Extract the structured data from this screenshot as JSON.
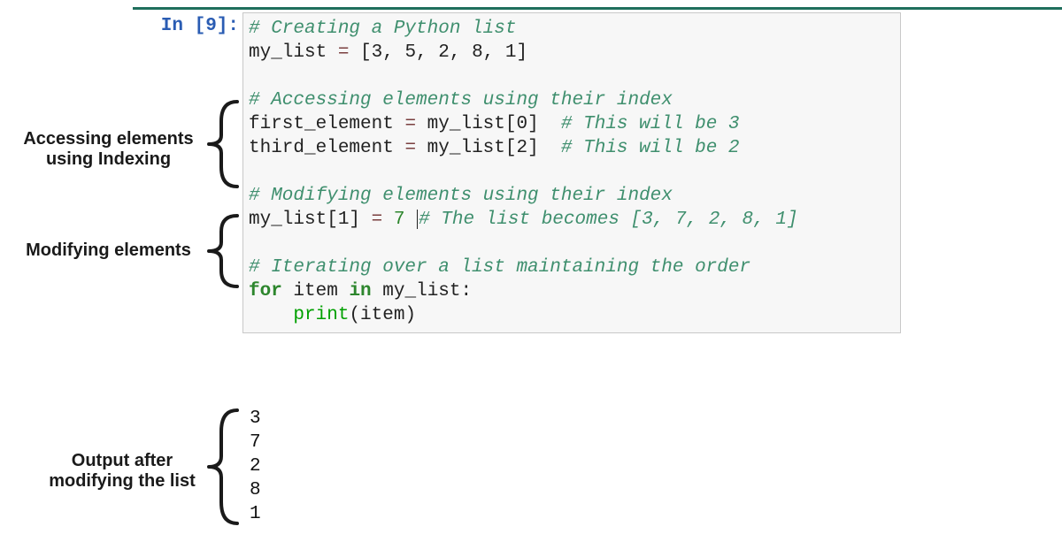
{
  "prompt": {
    "label": "In [9]:"
  },
  "code": {
    "l1_comment": "# Creating a Python list",
    "l2": {
      "lhs": "my_list",
      "rhs": "[3, 5, 2, 8, 1]"
    },
    "l4_comment": "# Accessing elements using their index",
    "l5": {
      "lhs": "first_element",
      "rhs": "my_list[0]",
      "note": "# This will be 3"
    },
    "l6": {
      "lhs": "third_element",
      "rhs": "my_list[2]",
      "note": "# This will be 2"
    },
    "l8_comment": "# Modifying elements using their index",
    "l9": {
      "lhs": "my_list[1]",
      "rhs": "7",
      "note": "# The list becomes [3, 7, 2, 8, 1]"
    },
    "l11_comment": "# Iterating over a list maintaining the order",
    "l12": {
      "kw_for": "for",
      "var": "item",
      "kw_in": "in",
      "target": "my_list:"
    },
    "l13": {
      "indent": "    ",
      "fn": "print",
      "args": "(item)"
    }
  },
  "output": {
    "v0": "3",
    "v1": "7",
    "v2": "2",
    "v3": "8",
    "v4": "1"
  },
  "annotations": {
    "indexing_l1": "Accessing elements",
    "indexing_l2": "using Indexing",
    "modifying": "Modifying elements",
    "output_l1": "Output after",
    "output_l2": "modifying the list"
  }
}
